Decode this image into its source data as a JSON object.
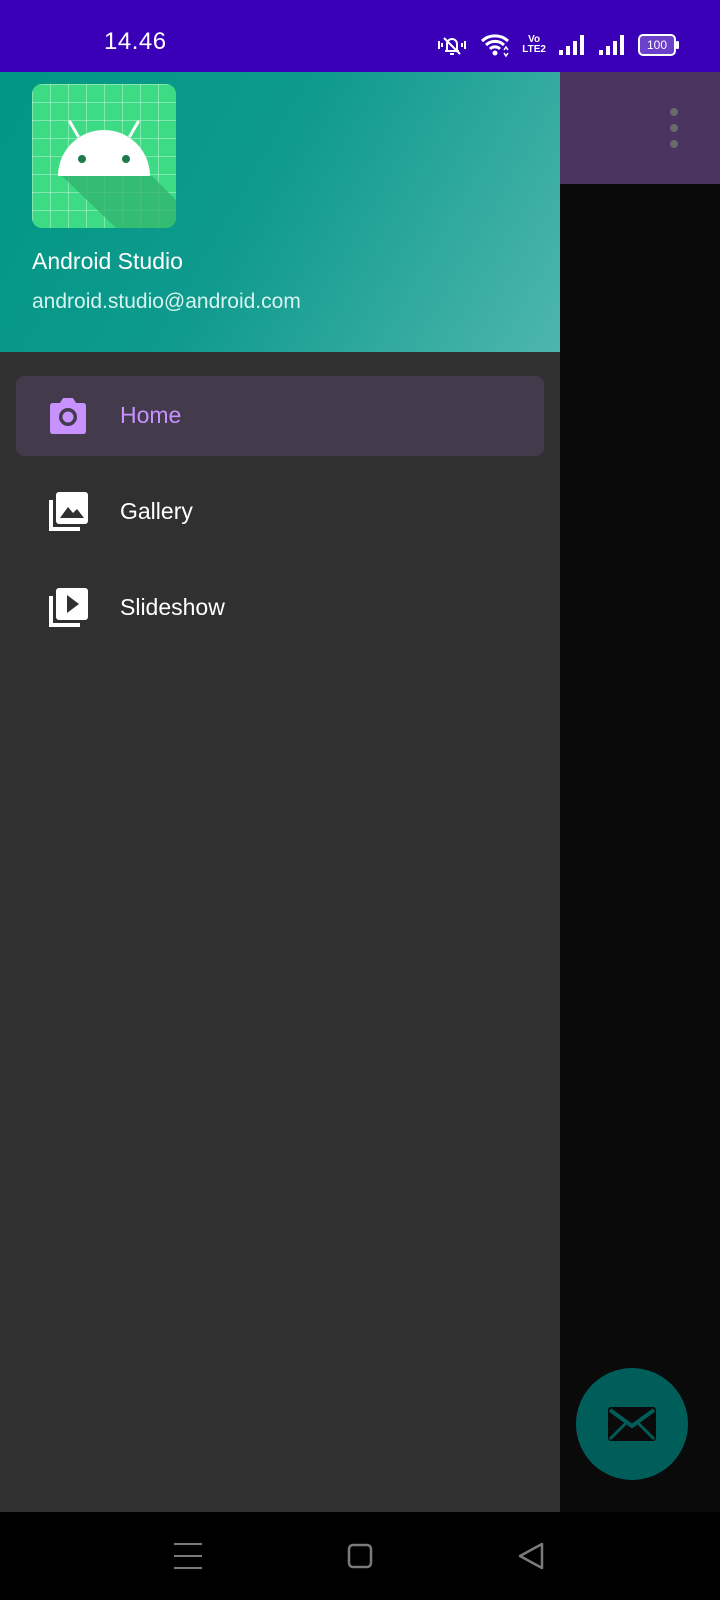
{
  "status_bar": {
    "time": "14.46",
    "volte_line1": "Vo",
    "volte_line2": "LTE2",
    "battery": "100",
    "icons": [
      "mute-vibrate-icon",
      "wifi-icon",
      "volte-icon",
      "signal-sim1-icon",
      "signal-sim2-icon",
      "battery-icon"
    ]
  },
  "drawer": {
    "header": {
      "user_name": "Android Studio",
      "user_email": "android.studio@android.com",
      "logo_icon": "android-logo-icon"
    },
    "items": [
      {
        "label": "Home",
        "icon": "camera-icon",
        "selected": true
      },
      {
        "label": "Gallery",
        "icon": "gallery-icon",
        "selected": false
      },
      {
        "label": "Slideshow",
        "icon": "slideshow-icon",
        "selected": false
      }
    ]
  },
  "app_bar": {
    "overflow_icon": "more-vert-icon"
  },
  "fab": {
    "icon": "mail-icon"
  },
  "nav_bar": {
    "buttons": [
      "menu-icon",
      "home-square-icon",
      "back-triangle-icon"
    ]
  },
  "colors": {
    "status_bar": "#3a00b8",
    "drawer_bg": "#303030",
    "selected_bg": "#433a4c",
    "selected_accent": "#c792ff",
    "header_gradient_start": "#009784",
    "header_gradient_end": "#4db6ac",
    "app_bar": "#4a3460",
    "fab": "#005e5a",
    "logo_green": "#3ddc84"
  }
}
